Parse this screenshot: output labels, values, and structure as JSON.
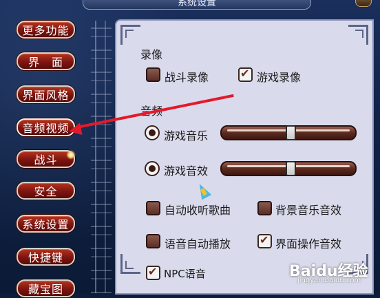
{
  "window": {
    "title": "系统设置"
  },
  "menu": {
    "items": [
      {
        "label": "更多功能"
      },
      {
        "label": "界　面"
      },
      {
        "label": "界面风格"
      },
      {
        "label": "音频视频"
      },
      {
        "label": "战斗"
      },
      {
        "label": "安全"
      },
      {
        "label": "系统设置"
      },
      {
        "label": "快捷键"
      },
      {
        "label": "藏宝图"
      }
    ]
  },
  "video": {
    "heading": "录像",
    "battle_record": {
      "label": "战斗录像",
      "checked": false
    },
    "game_record": {
      "label": "游戏录像",
      "checked": true
    }
  },
  "audio": {
    "heading": "音频",
    "music": {
      "label": "游戏音乐",
      "level": 0.52
    },
    "effects": {
      "label": "游戏音效",
      "level": 0.52
    },
    "auto_switch_song": {
      "label": "自动收听歌曲",
      "checked": false
    },
    "bg_music_effect": {
      "label": "背景音乐音效",
      "checked": false
    },
    "voice_autoplay": {
      "label": "语音自动播放",
      "checked": false
    },
    "ui_sound": {
      "label": "界面操作音效",
      "checked": true
    },
    "npc_voice": {
      "label": "NPC语音",
      "checked": true
    }
  },
  "watermark": {
    "text": "Baidu经验",
    "sub": "jingyan.baidu.com"
  },
  "colors": {
    "accent": "#e4192a",
    "panel": "#d9dbec",
    "button": "#7e1410"
  }
}
